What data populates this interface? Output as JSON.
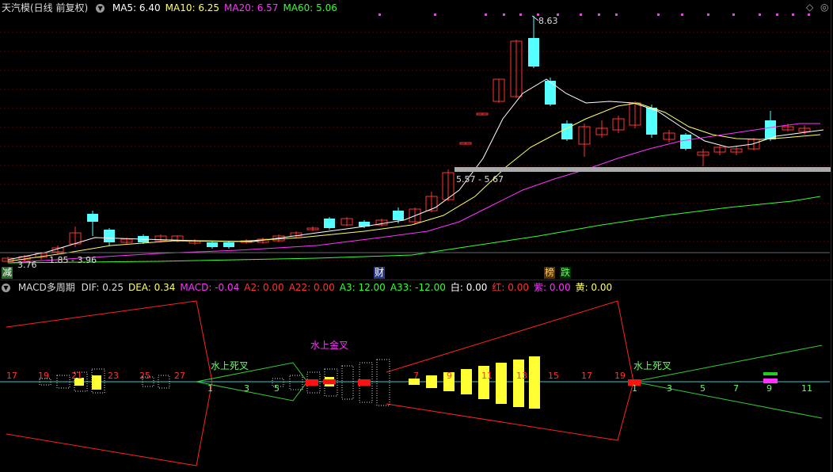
{
  "main": {
    "title": "天汽模(日线 前复权)",
    "ma": [
      {
        "label": "MA5: 6.40",
        "color": "#ffffff"
      },
      {
        "label": "MA10: 6.25",
        "color": "#ffff66"
      },
      {
        "label": "MA20: 6.57",
        "color": "#ff33ff"
      },
      {
        "label": "MA60: 5.06",
        "color": "#33ff33"
      }
    ],
    "annotations": {
      "high": "8.63",
      "range_upper": "5.57 - 5.67",
      "range_lower": "1.85 - 3.96",
      "low": "3.76"
    },
    "markers": [
      {
        "text": "减",
        "color": "#ffffff",
        "bg": "#2a6a2a"
      },
      {
        "text": "财",
        "color": "#ffffff",
        "bg": "#2a3a8a"
      },
      {
        "text": "榜",
        "color": "#ffcc66",
        "bg": "#553300"
      },
      {
        "text": "跌",
        "color": "#66ff66",
        "bg": "#003300"
      }
    ],
    "corner_icons": [
      "diamond-icon",
      "sync-icon"
    ]
  },
  "macd": {
    "title": "MACD多周期",
    "values": [
      {
        "label": "DIF: 0.25",
        "color": "#dddddd"
      },
      {
        "label": "DEA: 0.34",
        "color": "#ffff66"
      },
      {
        "label": "MACD: -0.04",
        "color": "#ff33ff"
      },
      {
        "label": "A2: 0.00",
        "color": "#ff3333"
      },
      {
        "label": "A22: 0.00",
        "color": "#ff3333"
      },
      {
        "label": "A3: 12.00",
        "color": "#33ff33"
      },
      {
        "label": "A33: -12.00",
        "color": "#33ff33"
      },
      {
        "label": "白: 0.00",
        "color": "#ffffff"
      },
      {
        "label": "红: 0.00",
        "color": "#ff3333"
      },
      {
        "label": "紫: 0.00",
        "color": "#ff33ff"
      },
      {
        "label": "黄: 0.00",
        "color": "#ffff66"
      }
    ],
    "labels": [
      {
        "text": "水上死叉",
        "color": "#66ff66"
      },
      {
        "text": "水上金叉",
        "color": "#ff33ff"
      },
      {
        "text": "水上死叉",
        "color": "#66ff66"
      }
    ],
    "counts": [
      {
        "text": "17",
        "color": "#ff3333"
      },
      {
        "text": "19",
        "color": "#ff3333"
      },
      {
        "text": "21",
        "color": "#ff3333"
      },
      {
        "text": "23",
        "color": "#ff3333"
      },
      {
        "text": "25",
        "color": "#ff3333"
      },
      {
        "text": "27",
        "color": "#ff3333"
      },
      {
        "text": "1",
        "color": "#66ff66"
      },
      {
        "text": "3",
        "color": "#66ff66"
      },
      {
        "text": "5",
        "color": "#66ff66"
      },
      {
        "text": "7",
        "color": "#ff3333"
      },
      {
        "text": "9",
        "color": "#ff3333"
      },
      {
        "text": "11",
        "color": "#ff3333"
      },
      {
        "text": "13",
        "color": "#ff3333"
      },
      {
        "text": "15",
        "color": "#ff3333"
      },
      {
        "text": "17",
        "color": "#ff3333"
      },
      {
        "text": "19",
        "color": "#ff3333"
      },
      {
        "text": "1",
        "color": "#66ff66"
      },
      {
        "text": "3",
        "color": "#66ff66"
      },
      {
        "text": "5",
        "color": "#66ff66"
      },
      {
        "text": "7",
        "color": "#66ff66"
      },
      {
        "text": "9",
        "color": "#66ff66"
      },
      {
        "text": "11",
        "color": "#66ff66"
      }
    ]
  },
  "colors": {
    "up": "#ff3333",
    "down": "#55ffff",
    "grid": "#5a0000",
    "frame": "#8b0000",
    "ma5": "#ffffff",
    "ma10": "#ffff66",
    "ma20": "#ff33ff",
    "ma60": "#33ff33",
    "zero": "#33cccc",
    "band": "#aaaaaa"
  }
}
